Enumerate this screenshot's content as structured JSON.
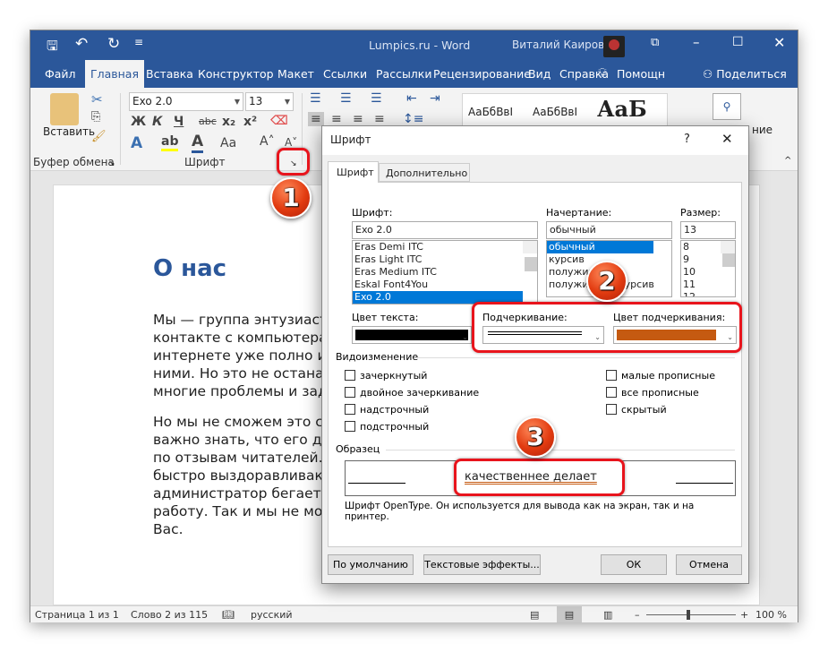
{
  "window": {
    "title": "Lumpics.ru - Word",
    "user": "Виталий Каиров"
  },
  "ribbon_tabs": [
    "Файл",
    "Главная",
    "Вставка",
    "Конструктор",
    "Макет",
    "Ссылки",
    "Рассылки",
    "Рецензирование",
    "Вид",
    "Справка",
    "Помощн",
    "Поделиться"
  ],
  "ribbon": {
    "paste": "Вставить",
    "font_name": "Exo 2.0",
    "font_size": "13",
    "clipboard_group": "Буфер обмена",
    "font_group": "Шрифт",
    "bold": "Ж",
    "italic": "К",
    "underline": "Ч",
    "strike": "abc",
    "styles": [
      "АаБбВвІ",
      "АаБбВвІ",
      "АаБ"
    ],
    "editing_partial": "ние"
  },
  "document": {
    "heading": "О нас",
    "para1": [
      "Мы — группа энтузиаст",
      "контакте с компьютера",
      "интернете уже полно и",
      "ними. Но это не останал",
      "многие проблемы и зад"
    ],
    "para2": [
      "Но мы не сможем это с",
      "важно знать, что его де",
      "по отзывам читателей.",
      "быстро выздоравливак",
      "администратор бегает",
      "работу. Так и мы не мо",
      "Вас."
    ]
  },
  "status": {
    "page": "Страница 1 из 1",
    "words": "Слово 2 из 115",
    "language": "русский",
    "zoom": "100 %",
    "zoom_level": 100
  },
  "dialog": {
    "title": "Шрифт",
    "help": "?",
    "tabs": [
      "Шрифт",
      "Дополнительно"
    ],
    "font_label": "Шрифт:",
    "font_value": "Exo 2.0",
    "font_list": [
      "Eras Demi ITC",
      "Eras Light ITC",
      "Eras Medium ITC",
      "Eskal Font4You",
      "Exo 2.0"
    ],
    "style_label": "Начертание:",
    "style_value": "обычный",
    "style_list": [
      "обычный",
      "курсив",
      "полужирный",
      "полужирный курсив"
    ],
    "size_label": "Размер:",
    "size_value": "13",
    "size_list": [
      "8",
      "9",
      "10",
      "11",
      "12"
    ],
    "text_color_label": "Цвет текста:",
    "text_color": "#000000",
    "underline_label": "Подчеркивание:",
    "underline_color_label": "Цвет подчеркивания:",
    "underline_color": "#c55a11",
    "effects_label": "Видоизменение",
    "effects_left": [
      "зачеркнутый",
      "двойное зачеркивание",
      "надстрочный",
      "подстрочный"
    ],
    "effects_right": [
      "малые прописные",
      "все прописные",
      "скрытый"
    ],
    "preview_label": "Образец",
    "preview_text": "качественнее делает",
    "preview_note": "Шрифт OpenType. Он используется для вывода как на экран, так и на принтер.",
    "btn_default": "По умолчанию",
    "btn_effects": "Текстовые эффекты...",
    "btn_ok": "ОК",
    "btn_cancel": "Отмена"
  },
  "callouts": [
    "1",
    "2",
    "3"
  ],
  "colors": {
    "accent": "#2b579a",
    "highlight": "#e8141c"
  }
}
